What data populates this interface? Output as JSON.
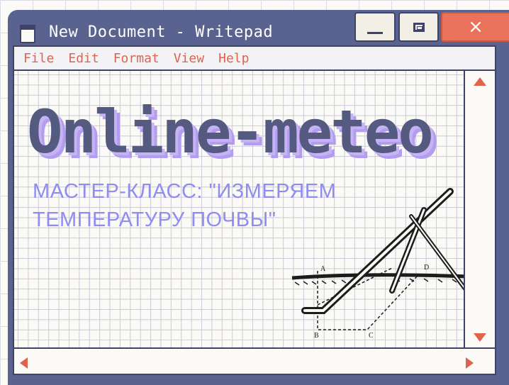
{
  "window": {
    "title": "New Document - Writepad",
    "buttons": {
      "minimize": "minimize",
      "maximize": "maximize",
      "close": "×"
    }
  },
  "menu": {
    "items": [
      {
        "label": "File"
      },
      {
        "label": "Edit"
      },
      {
        "label": "Format"
      },
      {
        "label": "View"
      },
      {
        "label": "Help"
      }
    ]
  },
  "document": {
    "headline": "Online-meteo",
    "subtitle": "МАСТЕР-КЛАСС: \"ИЗМЕРЯЕМ ТЕМПЕРАТУРУ ПОЧВЫ\"",
    "illustration": {
      "description_icon": "thermometer-illustration",
      "labels": [
        "A",
        "D",
        "B",
        "C"
      ]
    }
  },
  "colors": {
    "frame": "#5a6390",
    "accent": "#e0634e",
    "close_button": "#e8735a",
    "headline": "#545a80",
    "headline_shadow": "#b19ef0",
    "subtitle": "#8f8cf2"
  },
  "scrollbars": {
    "vertical": [
      "arrow-up-icon",
      "arrow-down-icon"
    ],
    "horizontal": [
      "arrow-left-icon",
      "arrow-right-icon"
    ]
  }
}
